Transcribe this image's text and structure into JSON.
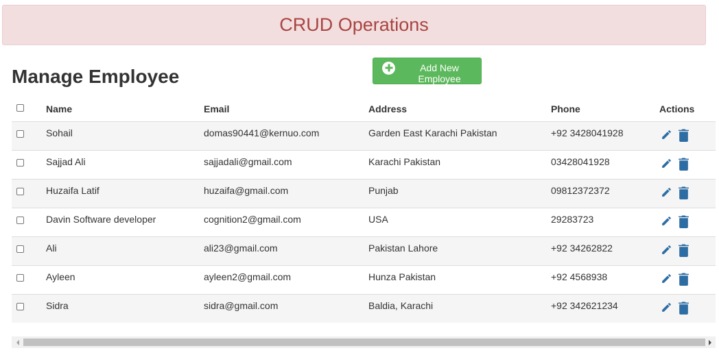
{
  "banner": {
    "title": "CRUD Operations"
  },
  "page": {
    "title": "Manage Employee"
  },
  "toolbar": {
    "add_label": "Add New Employee",
    "add_icon": "plus-circle-icon"
  },
  "colors": {
    "banner_bg": "#f2dede",
    "banner_text": "#a94442",
    "add_button": "#5cb85c",
    "action_icon": "#2e6da4"
  },
  "table": {
    "columns": [
      "Name",
      "Email",
      "Address",
      "Phone",
      "Actions"
    ],
    "rows": [
      {
        "name": "Sohail",
        "email": "domas90441@kernuo.com",
        "address": "Garden East Karachi Pakistan",
        "phone": "+92 3428041928"
      },
      {
        "name": "Sajjad Ali",
        "email": "sajjadali@gmail.com",
        "address": "Karachi Pakistan",
        "phone": "03428041928"
      },
      {
        "name": "Huzaifa Latif",
        "email": "huzaifa@gmail.com",
        "address": "Punjab",
        "phone": "09812372372"
      },
      {
        "name": "Davin Software developer",
        "email": "cognition2@gmail.com",
        "address": "USA",
        "phone": "29283723"
      },
      {
        "name": "Ali",
        "email": "ali23@gmail.com",
        "address": "Pakistan Lahore",
        "phone": "+92 34262822"
      },
      {
        "name": "Ayleen",
        "email": "ayleen2@gmail.com",
        "address": "Hunza Pakistan",
        "phone": "+92 4568938"
      },
      {
        "name": "Sidra",
        "email": "sidra@gmail.com",
        "address": "Baldia, Karachi",
        "phone": "+92 342621234"
      }
    ],
    "row_actions": [
      "edit-icon",
      "delete-icon"
    ]
  }
}
